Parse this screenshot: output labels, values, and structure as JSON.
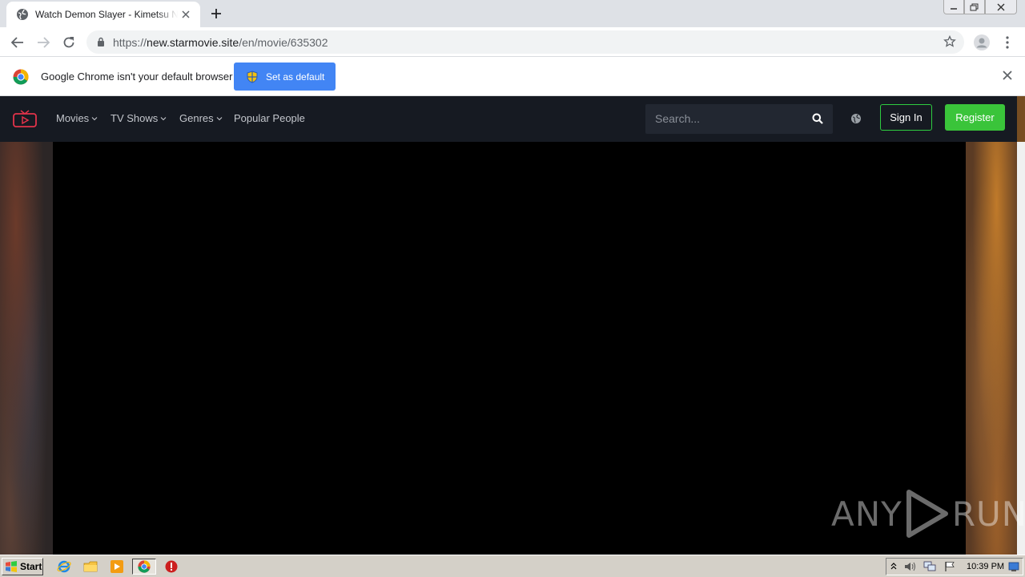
{
  "browser": {
    "tab": {
      "title": "Watch Demon Slayer - Kimetsu No Yaiba",
      "favicon": "globe-icon"
    },
    "url": {
      "scheme": "https://",
      "host": "new.starmovie.site",
      "path": "/en/movie/635302"
    },
    "infobar": {
      "message": "Google Chrome isn't your default browser",
      "button": "Set as default"
    }
  },
  "site": {
    "nav": [
      {
        "label": "Movies"
      },
      {
        "label": "TV Shows"
      },
      {
        "label": "Genres"
      },
      {
        "label": "Popular People"
      }
    ],
    "search": {
      "placeholder": "Search..."
    },
    "signin": "Sign In",
    "register": "Register",
    "colors": {
      "navbar": "#161a22",
      "accent_green": "#3ac43a",
      "logo": "#e2334a"
    }
  },
  "watermark": {
    "left": "ANY",
    "right": "RUN"
  },
  "taskbar": {
    "start": "Start",
    "apps": [
      "ie-icon",
      "explorer-icon",
      "media-player-icon",
      "chrome-icon",
      "stop-icon"
    ],
    "clock": "10:39 PM"
  }
}
